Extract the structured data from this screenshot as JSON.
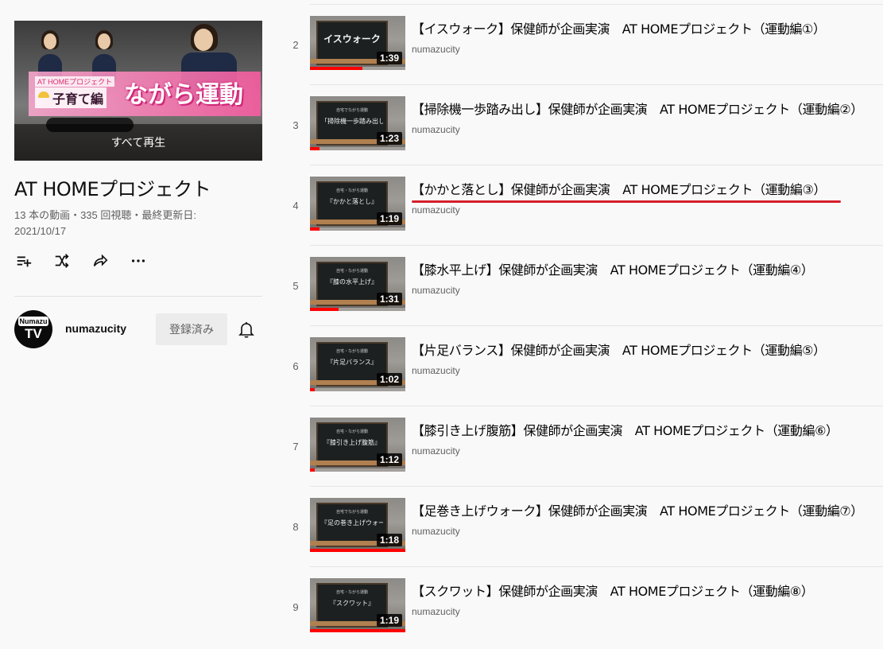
{
  "playlist": {
    "thumb_overlay": "すべて再生",
    "thumb_banner_small": "AT HOMEプロジェクト",
    "thumb_banner_sub": "子育て編",
    "thumb_banner_main": "ながら運動",
    "title": "AT HOMEプロジェクト",
    "stats": "13 本の動画・335 回視聴・最終更新日: 2021/10/17",
    "actions": [
      "add-to-queue-icon",
      "shuffle-icon",
      "share-icon",
      "more-icon"
    ]
  },
  "channel": {
    "avatar_line1": "Numazu",
    "avatar_line2": "TV",
    "name": "numazucity",
    "subscribe_label": "登録済み"
  },
  "videos": [
    {
      "index": "2",
      "title": "【イスウォーク】保健師が企画実演　AT HOMEプロジェクト（運動編①）",
      "channel": "numazucity",
      "duration": "1:39",
      "board_small": "",
      "board_text": "イスウォーク",
      "progress": 0.55
    },
    {
      "index": "3",
      "title": "【掃除機一歩踏み出し】保健師が企画実演　AT HOMEプロジェクト（運動編②）",
      "channel": "numazucity",
      "duration": "1:23",
      "board_small": "自宅でながら運動",
      "board_text": "「掃除機一歩踏み出し運動」",
      "progress": 0.1
    },
    {
      "index": "4",
      "title": "【かかと落とし】保健師が企画実演　AT HOMEプロジェクト（運動編③）",
      "channel": "numazucity",
      "duration": "1:19",
      "board_small": "自宅・ながら運動",
      "board_text": "『かかと落とし』",
      "progress": 0.1
    },
    {
      "index": "5",
      "title": "【膝水平上げ】保健師が企画実演　AT HOMEプロジェクト（運動編④）",
      "channel": "numazucity",
      "duration": "1:31",
      "board_small": "自宅・ながら運動",
      "board_text": "『膝の水平上げ』",
      "progress": 0.3
    },
    {
      "index": "6",
      "title": "【片足バランス】保健師が企画実演　AT HOMEプロジェクト（運動編⑤）",
      "channel": "numazucity",
      "duration": "1:02",
      "board_small": "自宅・ながら運動",
      "board_text": "『片足バランス』",
      "progress": 0.05
    },
    {
      "index": "7",
      "title": "【膝引き上げ腹筋】保健師が企画実演　AT HOMEプロジェクト（運動編⑥）",
      "channel": "numazucity",
      "duration": "1:12",
      "board_small": "自宅・ながら運動",
      "board_text": "『膝引き上げ腹筋』",
      "progress": 0.05
    },
    {
      "index": "8",
      "title": "【足巻き上げウォーク】保健師が企画実演　AT HOMEプロジェクト（運動編⑦）",
      "channel": "numazucity",
      "duration": "1:18",
      "board_small": "自宅でながら運動",
      "board_text": "『足の巻き上げウォーク』",
      "progress": 1.0
    },
    {
      "index": "9",
      "title": "【スクワット】保健師が企画実演　AT HOMEプロジェクト（運動編⑧）",
      "channel": "numazucity",
      "duration": "1:19",
      "board_small": "自宅・ながら運動",
      "board_text": "『スクワット』",
      "progress": 1.0
    }
  ],
  "highlighted_index": 2,
  "colors": {
    "accent": "#ff0000",
    "underline": "#d61f2b",
    "banner": "#f65ca0"
  }
}
